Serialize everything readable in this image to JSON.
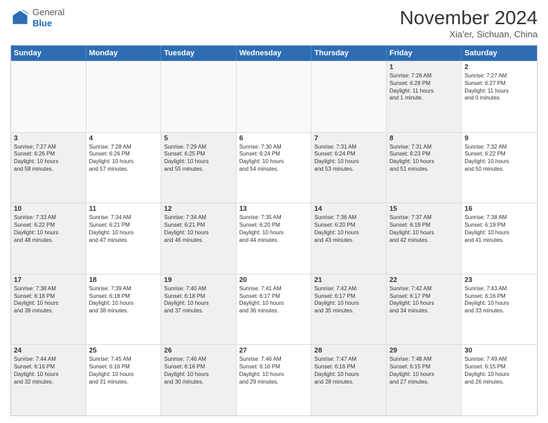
{
  "header": {
    "logo_general": "General",
    "logo_blue": "Blue",
    "month_title": "November 2024",
    "location": "Xia'er, Sichuan, China"
  },
  "weekdays": [
    "Sunday",
    "Monday",
    "Tuesday",
    "Wednesday",
    "Thursday",
    "Friday",
    "Saturday"
  ],
  "rows": [
    [
      {
        "day": "",
        "info": "",
        "empty": true
      },
      {
        "day": "",
        "info": "",
        "empty": true
      },
      {
        "day": "",
        "info": "",
        "empty": true
      },
      {
        "day": "",
        "info": "",
        "empty": true
      },
      {
        "day": "",
        "info": "",
        "empty": true
      },
      {
        "day": "1",
        "info": "Sunrise: 7:26 AM\nSunset: 6:28 PM\nDaylight: 11 hours\nand 1 minute.",
        "shaded": true
      },
      {
        "day": "2",
        "info": "Sunrise: 7:27 AM\nSunset: 6:27 PM\nDaylight: 11 hours\nand 0 minutes."
      }
    ],
    [
      {
        "day": "3",
        "info": "Sunrise: 7:27 AM\nSunset: 6:26 PM\nDaylight: 10 hours\nand 58 minutes.",
        "shaded": true
      },
      {
        "day": "4",
        "info": "Sunrise: 7:28 AM\nSunset: 6:26 PM\nDaylight: 10 hours\nand 57 minutes."
      },
      {
        "day": "5",
        "info": "Sunrise: 7:29 AM\nSunset: 6:25 PM\nDaylight: 10 hours\nand 55 minutes.",
        "shaded": true
      },
      {
        "day": "6",
        "info": "Sunrise: 7:30 AM\nSunset: 6:24 PM\nDaylight: 10 hours\nand 54 minutes."
      },
      {
        "day": "7",
        "info": "Sunrise: 7:31 AM\nSunset: 6:24 PM\nDaylight: 10 hours\nand 53 minutes.",
        "shaded": true
      },
      {
        "day": "8",
        "info": "Sunrise: 7:31 AM\nSunset: 6:23 PM\nDaylight: 10 hours\nand 51 minutes.",
        "shaded": true
      },
      {
        "day": "9",
        "info": "Sunrise: 7:32 AM\nSunset: 6:22 PM\nDaylight: 10 hours\nand 50 minutes."
      }
    ],
    [
      {
        "day": "10",
        "info": "Sunrise: 7:33 AM\nSunset: 6:22 PM\nDaylight: 10 hours\nand 48 minutes.",
        "shaded": true
      },
      {
        "day": "11",
        "info": "Sunrise: 7:34 AM\nSunset: 6:21 PM\nDaylight: 10 hours\nand 47 minutes."
      },
      {
        "day": "12",
        "info": "Sunrise: 7:34 AM\nSunset: 6:21 PM\nDaylight: 10 hours\nand 46 minutes.",
        "shaded": true
      },
      {
        "day": "13",
        "info": "Sunrise: 7:35 AM\nSunset: 6:20 PM\nDaylight: 10 hours\nand 44 minutes."
      },
      {
        "day": "14",
        "info": "Sunrise: 7:36 AM\nSunset: 6:20 PM\nDaylight: 10 hours\nand 43 minutes.",
        "shaded": true
      },
      {
        "day": "15",
        "info": "Sunrise: 7:37 AM\nSunset: 6:19 PM\nDaylight: 10 hours\nand 42 minutes.",
        "shaded": true
      },
      {
        "day": "16",
        "info": "Sunrise: 7:38 AM\nSunset: 6:19 PM\nDaylight: 10 hours\nand 41 minutes."
      }
    ],
    [
      {
        "day": "17",
        "info": "Sunrise: 7:38 AM\nSunset: 6:18 PM\nDaylight: 10 hours\nand 39 minutes.",
        "shaded": true
      },
      {
        "day": "18",
        "info": "Sunrise: 7:39 AM\nSunset: 6:18 PM\nDaylight: 10 hours\nand 38 minutes."
      },
      {
        "day": "19",
        "info": "Sunrise: 7:40 AM\nSunset: 6:18 PM\nDaylight: 10 hours\nand 37 minutes.",
        "shaded": true
      },
      {
        "day": "20",
        "info": "Sunrise: 7:41 AM\nSunset: 6:17 PM\nDaylight: 10 hours\nand 36 minutes."
      },
      {
        "day": "21",
        "info": "Sunrise: 7:42 AM\nSunset: 6:17 PM\nDaylight: 10 hours\nand 35 minutes.",
        "shaded": true
      },
      {
        "day": "22",
        "info": "Sunrise: 7:42 AM\nSunset: 6:17 PM\nDaylight: 10 hours\nand 34 minutes.",
        "shaded": true
      },
      {
        "day": "23",
        "info": "Sunrise: 7:43 AM\nSunset: 6:16 PM\nDaylight: 10 hours\nand 33 minutes."
      }
    ],
    [
      {
        "day": "24",
        "info": "Sunrise: 7:44 AM\nSunset: 6:16 PM\nDaylight: 10 hours\nand 32 minutes.",
        "shaded": true
      },
      {
        "day": "25",
        "info": "Sunrise: 7:45 AM\nSunset: 6:16 PM\nDaylight: 10 hours\nand 31 minutes."
      },
      {
        "day": "26",
        "info": "Sunrise: 7:46 AM\nSunset: 6:16 PM\nDaylight: 10 hours\nand 30 minutes.",
        "shaded": true
      },
      {
        "day": "27",
        "info": "Sunrise: 7:46 AM\nSunset: 6:16 PM\nDaylight: 10 hours\nand 29 minutes."
      },
      {
        "day": "28",
        "info": "Sunrise: 7:47 AM\nSunset: 6:16 PM\nDaylight: 10 hours\nand 28 minutes.",
        "shaded": true
      },
      {
        "day": "29",
        "info": "Sunrise: 7:48 AM\nSunset: 6:15 PM\nDaylight: 10 hours\nand 27 minutes.",
        "shaded": true
      },
      {
        "day": "30",
        "info": "Sunrise: 7:49 AM\nSunset: 6:15 PM\nDaylight: 10 hours\nand 26 minutes."
      }
    ]
  ]
}
